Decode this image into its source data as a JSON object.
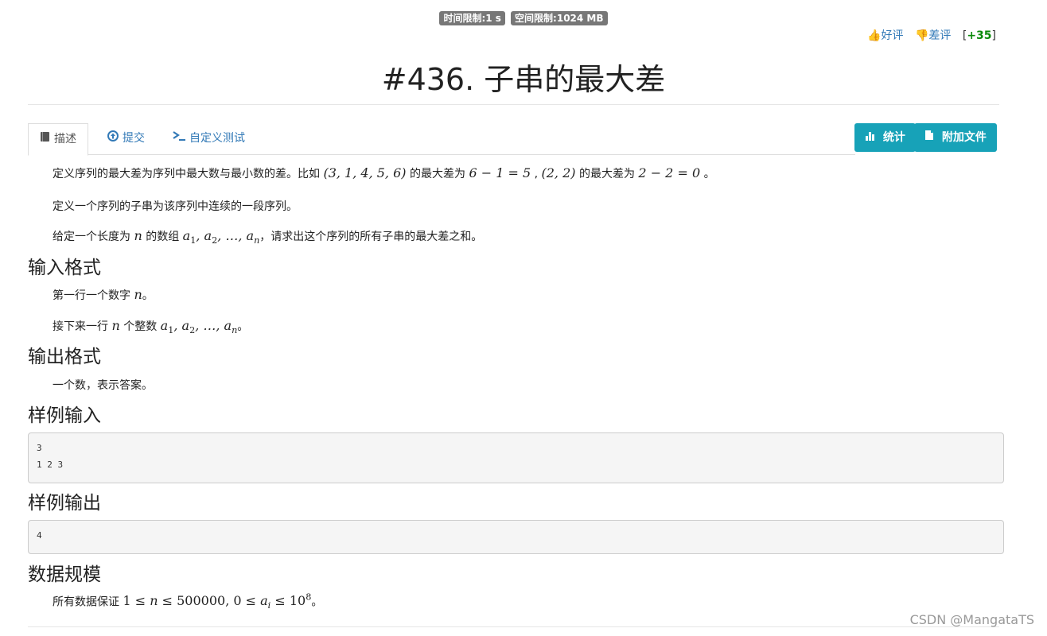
{
  "limits": {
    "time": "时间限制:1 s",
    "memory": "空间限制:1024 MB"
  },
  "votes": {
    "like": "好评",
    "dislike": "差评",
    "score_open": "[",
    "score": "+35",
    "score_close": "]"
  },
  "problem": {
    "title": "#436. 子串的最大差"
  },
  "tabs": [
    {
      "label": "描述",
      "icon": "book-icon"
    },
    {
      "label": "提交",
      "icon": "upload-circle-icon"
    },
    {
      "label": "自定义测试",
      "icon": "terminal-icon"
    }
  ],
  "actions": {
    "stats": "统计",
    "attachments": "附加文件"
  },
  "description": {
    "p1_a": "定义序列的最大差为序列中最大数与最小数的差。比如",
    "p1_m1": "(3, 1, 4, 5, 6)",
    "p1_b": "的最大差为",
    "p1_m2": "6 − 1 = 5",
    "p1_c": ",",
    "p1_m3": "(2, 2)",
    "p1_d": "的最大差为",
    "p1_m4": "2 − 2 = 0",
    "p1_e": "。",
    "p2": "定义一个序列的子串为该序列中连续的一段序列。",
    "p3_a": "给定一个长度为",
    "p3_b": "的数组",
    "p3_c": "，请求出这个序列的所有子串的最大差之和。"
  },
  "input_format": {
    "heading": "输入格式",
    "l1_a": "第一行一个数字",
    "l1_b": "。",
    "l2_a": "接下来一行",
    "l2_b": "个整数",
    "l2_c": "。"
  },
  "output_format": {
    "heading": "输出格式",
    "text": "一个数，表示答案。"
  },
  "sample_input": {
    "heading": "样例输入",
    "content": "3\n1 2 3"
  },
  "sample_output": {
    "heading": "样例输出",
    "content": "4"
  },
  "constraints": {
    "heading": "数据规模",
    "text_a": "所有数据保证",
    "text_b": "。"
  },
  "watermark": "CSDN @MangataTS"
}
